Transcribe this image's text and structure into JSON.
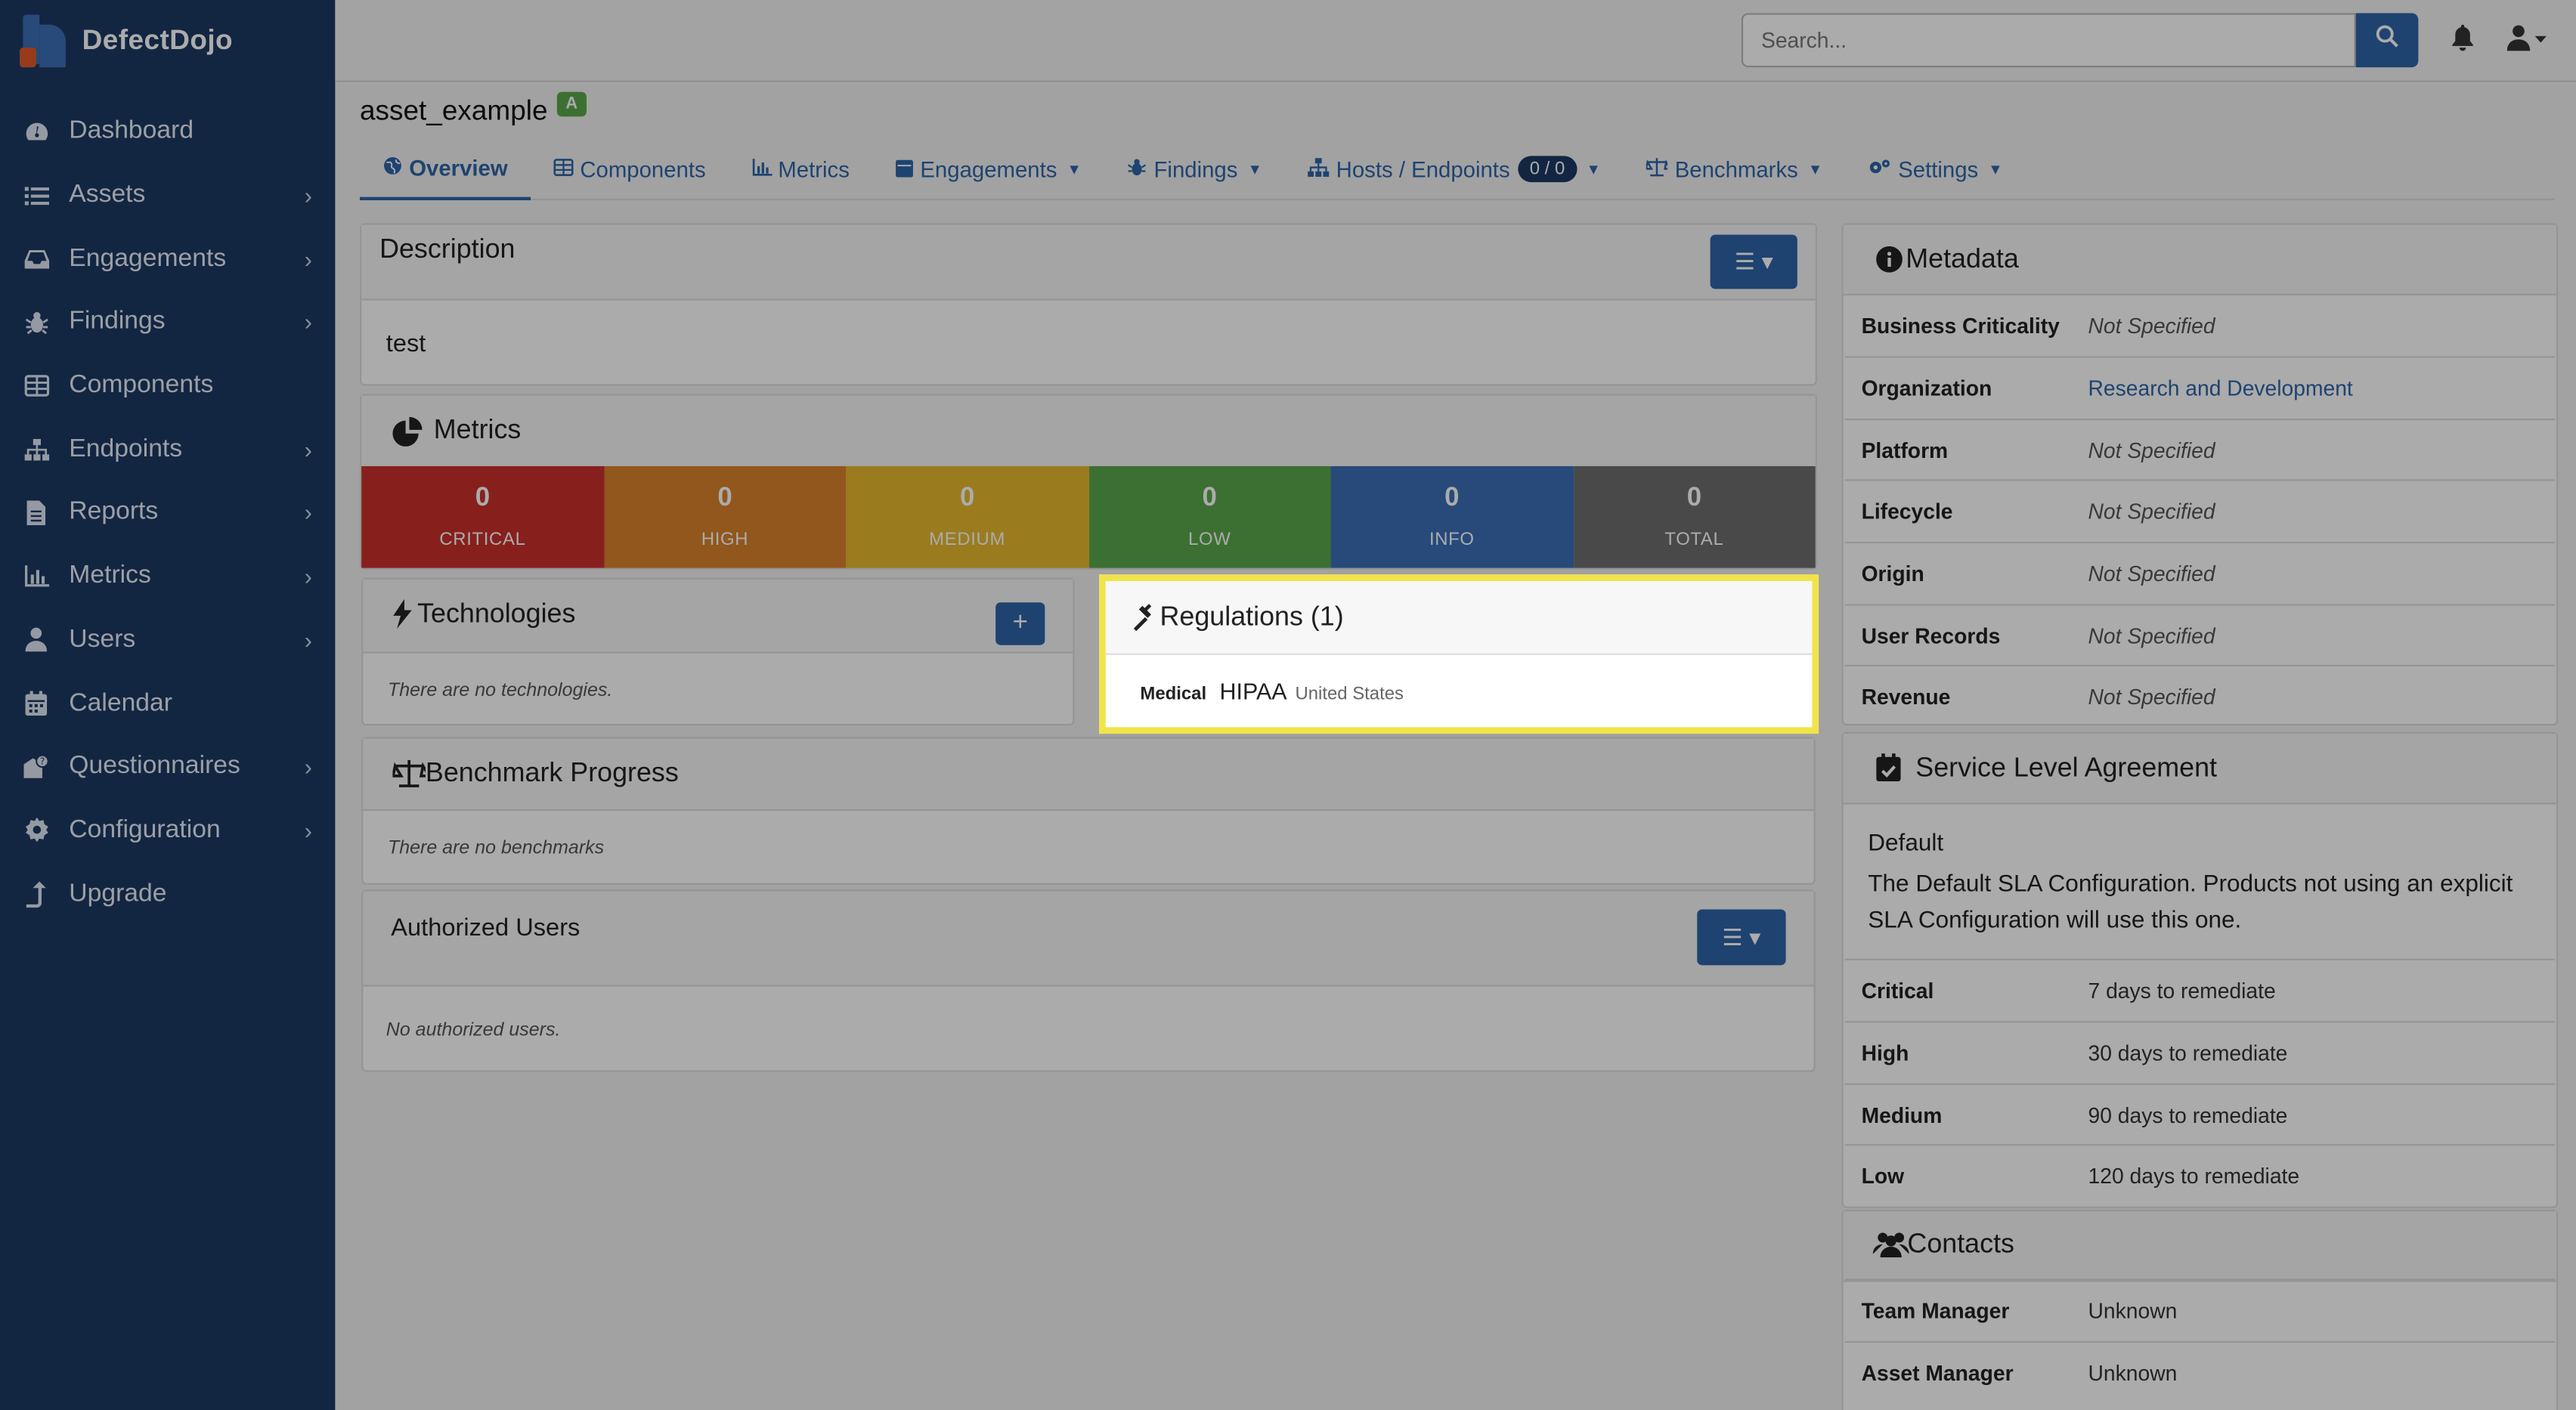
{
  "app": {
    "name": "DefectDojo"
  },
  "sidebar": {
    "items": [
      {
        "label": "Dashboard",
        "icon": "dashboard-icon",
        "expandable": false
      },
      {
        "label": "Assets",
        "icon": "list-icon",
        "expandable": true
      },
      {
        "label": "Engagements",
        "icon": "inbox-icon",
        "expandable": true
      },
      {
        "label": "Findings",
        "icon": "bug-icon",
        "expandable": true
      },
      {
        "label": "Components",
        "icon": "table-icon",
        "expandable": false
      },
      {
        "label": "Endpoints",
        "icon": "sitemap-icon",
        "expandable": true
      },
      {
        "label": "Reports",
        "icon": "file-icon",
        "expandable": true
      },
      {
        "label": "Metrics",
        "icon": "bar-chart-icon",
        "expandable": true
      },
      {
        "label": "Users",
        "icon": "user-icon",
        "expandable": true
      },
      {
        "label": "Calendar",
        "icon": "calendar-icon",
        "expandable": false
      },
      {
        "label": "Questionnaires",
        "icon": "questionnaire-icon",
        "expandable": true
      },
      {
        "label": "Configuration",
        "icon": "gear-icon",
        "expandable": true
      },
      {
        "label": "Upgrade",
        "icon": "upgrade-icon",
        "expandable": false
      }
    ]
  },
  "header": {
    "search_placeholder": "Search..."
  },
  "asset": {
    "name": "asset_example",
    "badge": "A"
  },
  "tabs": [
    {
      "label": "Overview",
      "icon": "globe-icon",
      "dropdown": false,
      "active": true
    },
    {
      "label": "Components",
      "icon": "table-icon",
      "dropdown": false
    },
    {
      "label": "Metrics",
      "icon": "bar-chart-icon",
      "dropdown": false
    },
    {
      "label": "Engagements",
      "icon": "calendar-icon",
      "dropdown": true
    },
    {
      "label": "Findings",
      "icon": "bug-icon",
      "dropdown": true
    },
    {
      "label": "Hosts / Endpoints",
      "icon": "sitemap-icon",
      "dropdown": true,
      "count": "0 / 0"
    },
    {
      "label": "Benchmarks",
      "icon": "balance-icon",
      "dropdown": true
    },
    {
      "label": "Settings",
      "icon": "gears-icon",
      "dropdown": true
    }
  ],
  "description": {
    "title": "Description",
    "text": "test"
  },
  "metrics": {
    "title": "Metrics",
    "cells": [
      {
        "label": "CRITICAL",
        "value": "0",
        "color": "#c9302c"
      },
      {
        "label": "HIGH",
        "value": "0",
        "color": "#d9822b"
      },
      {
        "label": "MEDIUM",
        "value": "0",
        "color": "#e6b82e"
      },
      {
        "label": "LOW",
        "value": "0",
        "color": "#5aa84b"
      },
      {
        "label": "INFO",
        "value": "0",
        "color": "#3b6fb6"
      },
      {
        "label": "TOTAL",
        "value": "0",
        "color": "#6e6e6e"
      }
    ]
  },
  "technologies": {
    "title": "Technologies",
    "empty": "There are no technologies."
  },
  "regulations": {
    "title": "Regulations (1)",
    "category": "Medical",
    "name": "HIPAA",
    "jurisdiction": "United States"
  },
  "benchmark": {
    "title": "Benchmark Progress",
    "empty": "There are no benchmarks"
  },
  "authorized_users": {
    "title": "Authorized Users",
    "empty": "No authorized users."
  },
  "metadata": {
    "title": "Metadata",
    "rows": [
      {
        "key": "Business Criticality",
        "value": "Not Specified"
      },
      {
        "key": "Organization",
        "value": "Research and Development",
        "link": true
      },
      {
        "key": "Platform",
        "value": "Not Specified"
      },
      {
        "key": "Lifecycle",
        "value": "Not Specified"
      },
      {
        "key": "Origin",
        "value": "Not Specified"
      },
      {
        "key": "User Records",
        "value": "Not Specified"
      },
      {
        "key": "Revenue",
        "value": "Not Specified"
      }
    ]
  },
  "sla": {
    "title": "Service Level Agreement",
    "name": "Default",
    "description": "The Default SLA Configuration. Products not using an explicit SLA Configuration will use this one.",
    "rows": [
      {
        "key": "Critical",
        "value": "7 days to remediate"
      },
      {
        "key": "High",
        "value": "30 days to remediate"
      },
      {
        "key": "Medium",
        "value": "90 days to remediate"
      },
      {
        "key": "Low",
        "value": "120 days to remediate"
      }
    ]
  },
  "contacts": {
    "title": "Contacts",
    "rows": [
      {
        "key": "Team Manager",
        "value": "Unknown"
      },
      {
        "key": "Asset Manager",
        "value": "Unknown"
      }
    ]
  }
}
